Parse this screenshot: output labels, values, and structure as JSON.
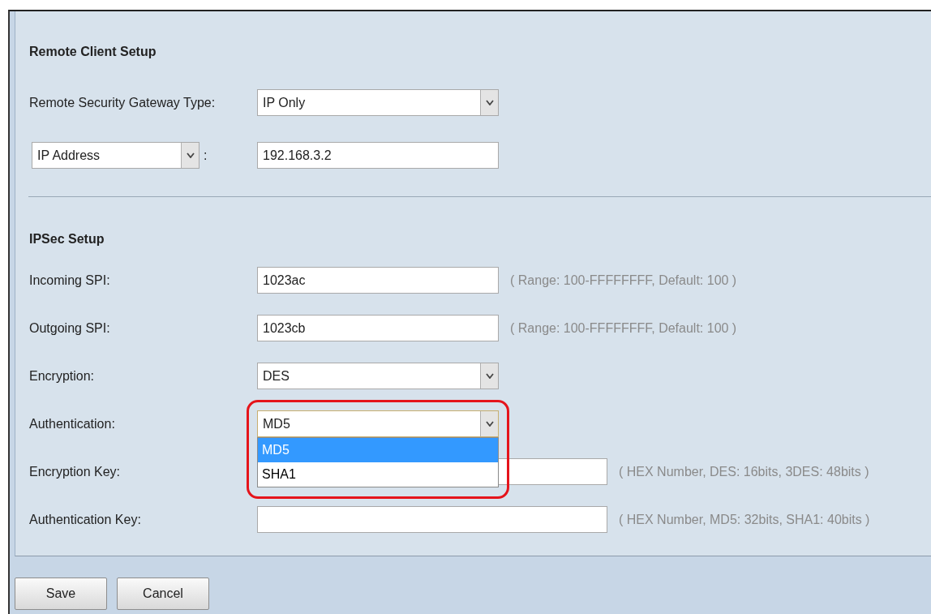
{
  "remote_client_setup": {
    "title": "Remote Client Setup",
    "gateway_type": {
      "label": "Remote Security Gateway Type:",
      "value": "IP Only"
    },
    "identifier": {
      "type_value": "IP Address",
      "separator": ":",
      "value": "192.168.3.2"
    }
  },
  "ipsec_setup": {
    "title": "IPSec Setup",
    "fields": [
      {
        "kind": "input",
        "label": "Incoming SPI:",
        "value": "1023ac",
        "hint": "( Range: 100-FFFFFFFF, Default: 100 )"
      },
      {
        "kind": "input",
        "label": "Outgoing SPI:",
        "value": "1023cb",
        "hint": "( Range: 100-FFFFFFFF, Default: 100 )"
      },
      {
        "kind": "select",
        "label": "Encryption:",
        "value": "DES",
        "expanded": false
      },
      {
        "kind": "select",
        "label": "Authentication:",
        "value": "MD5",
        "expanded": true,
        "highlighted": true,
        "options": [
          {
            "label": "MD5",
            "selected": true
          },
          {
            "label": "SHA1",
            "selected": false
          }
        ]
      },
      {
        "kind": "key_input",
        "label": "Encryption Key:",
        "hint": "( HEX Number, DES: 16bits, 3DES: 48bits )"
      },
      {
        "kind": "key_input",
        "label": "Authentication Key:",
        "hint": "( HEX Number, MD5: 32bits, SHA1: 40bits )"
      }
    ]
  },
  "buttons": [
    "Save",
    "Cancel"
  ]
}
